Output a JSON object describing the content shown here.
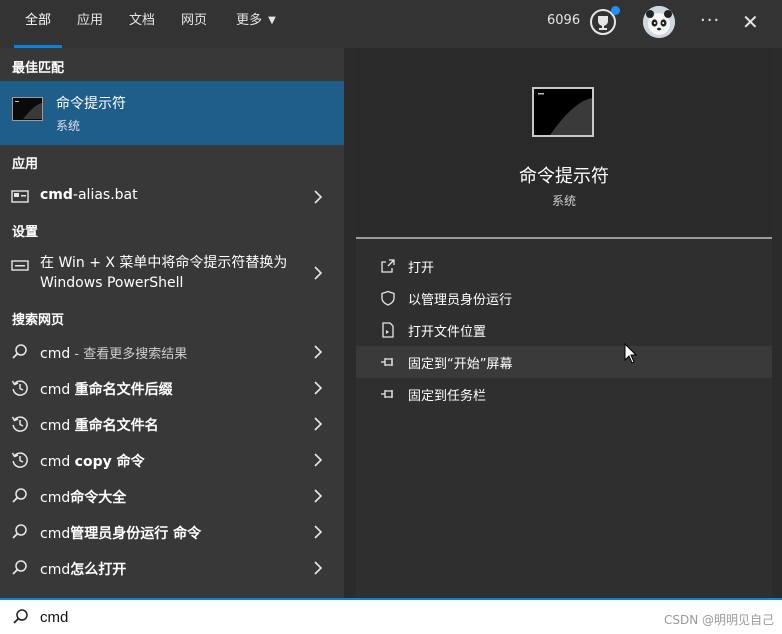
{
  "tabs": [
    {
      "label": "全部",
      "active": true
    },
    {
      "label": "应用"
    },
    {
      "label": "文档"
    },
    {
      "label": "网页"
    },
    {
      "label": "更多",
      "has_dropdown": true
    }
  ],
  "header": {
    "points": "6096",
    "trophy_icon": "trophy-icon",
    "avatar_icon": "panda-avatar",
    "more_icon": "ellipsis-icon",
    "close_icon": "close-icon",
    "accent_color": "#0a84d8",
    "notification_color": "#1e90ff"
  },
  "sections": {
    "best_match": "最佳匹配",
    "apps": "应用",
    "settings": "设置",
    "web": "搜索网页"
  },
  "best_match": {
    "title": "命令提示符",
    "subtitle": "系统",
    "icon": "terminal-icon",
    "highlight_color": "#1f5d8a"
  },
  "apps": [
    {
      "bold": "cmd",
      "rest": "-alias.bat",
      "icon": "batch-file-icon"
    }
  ],
  "settings": [
    {
      "label": "在 Win + X 菜单中将命令提示符替换为 Windows PowerShell",
      "icon": "settings-keyboard-icon"
    }
  ],
  "web_results": [
    {
      "prefix": "cmd",
      "bold": "",
      "dim": " - 查看更多搜索结果",
      "icon": "search-icon"
    },
    {
      "prefix": "cmd ",
      "bold": "重命名文件后缀",
      "dim": "",
      "icon": "history-icon"
    },
    {
      "prefix": "cmd ",
      "bold": "重命名文件名",
      "dim": "",
      "icon": "history-icon"
    },
    {
      "prefix": "cmd ",
      "bold": "copy 命令",
      "dim": "",
      "icon": "history-icon"
    },
    {
      "prefix": "cmd",
      "bold": "命令大全",
      "dim": "",
      "icon": "search-icon"
    },
    {
      "prefix": "cmd",
      "bold": "管理员身份运行 命令",
      "dim": "",
      "icon": "search-icon"
    },
    {
      "prefix": "cmd",
      "bold": "怎么打开",
      "dim": "",
      "icon": "search-icon"
    }
  ],
  "preview": {
    "title": "命令提示符",
    "subtitle": "系统",
    "actions": [
      {
        "label": "打开",
        "icon": "open-icon"
      },
      {
        "label": "以管理员身份运行",
        "icon": "shield-icon"
      },
      {
        "label": "打开文件位置",
        "icon": "file-location-icon"
      },
      {
        "label": "固定到“开始”屏幕",
        "icon": "pin-icon",
        "hovered": true
      },
      {
        "label": "固定到任务栏",
        "icon": "pin-icon"
      }
    ]
  },
  "search": {
    "value": "cmd",
    "icon": "search-icon"
  },
  "watermark": "CSDN @明明见自己"
}
